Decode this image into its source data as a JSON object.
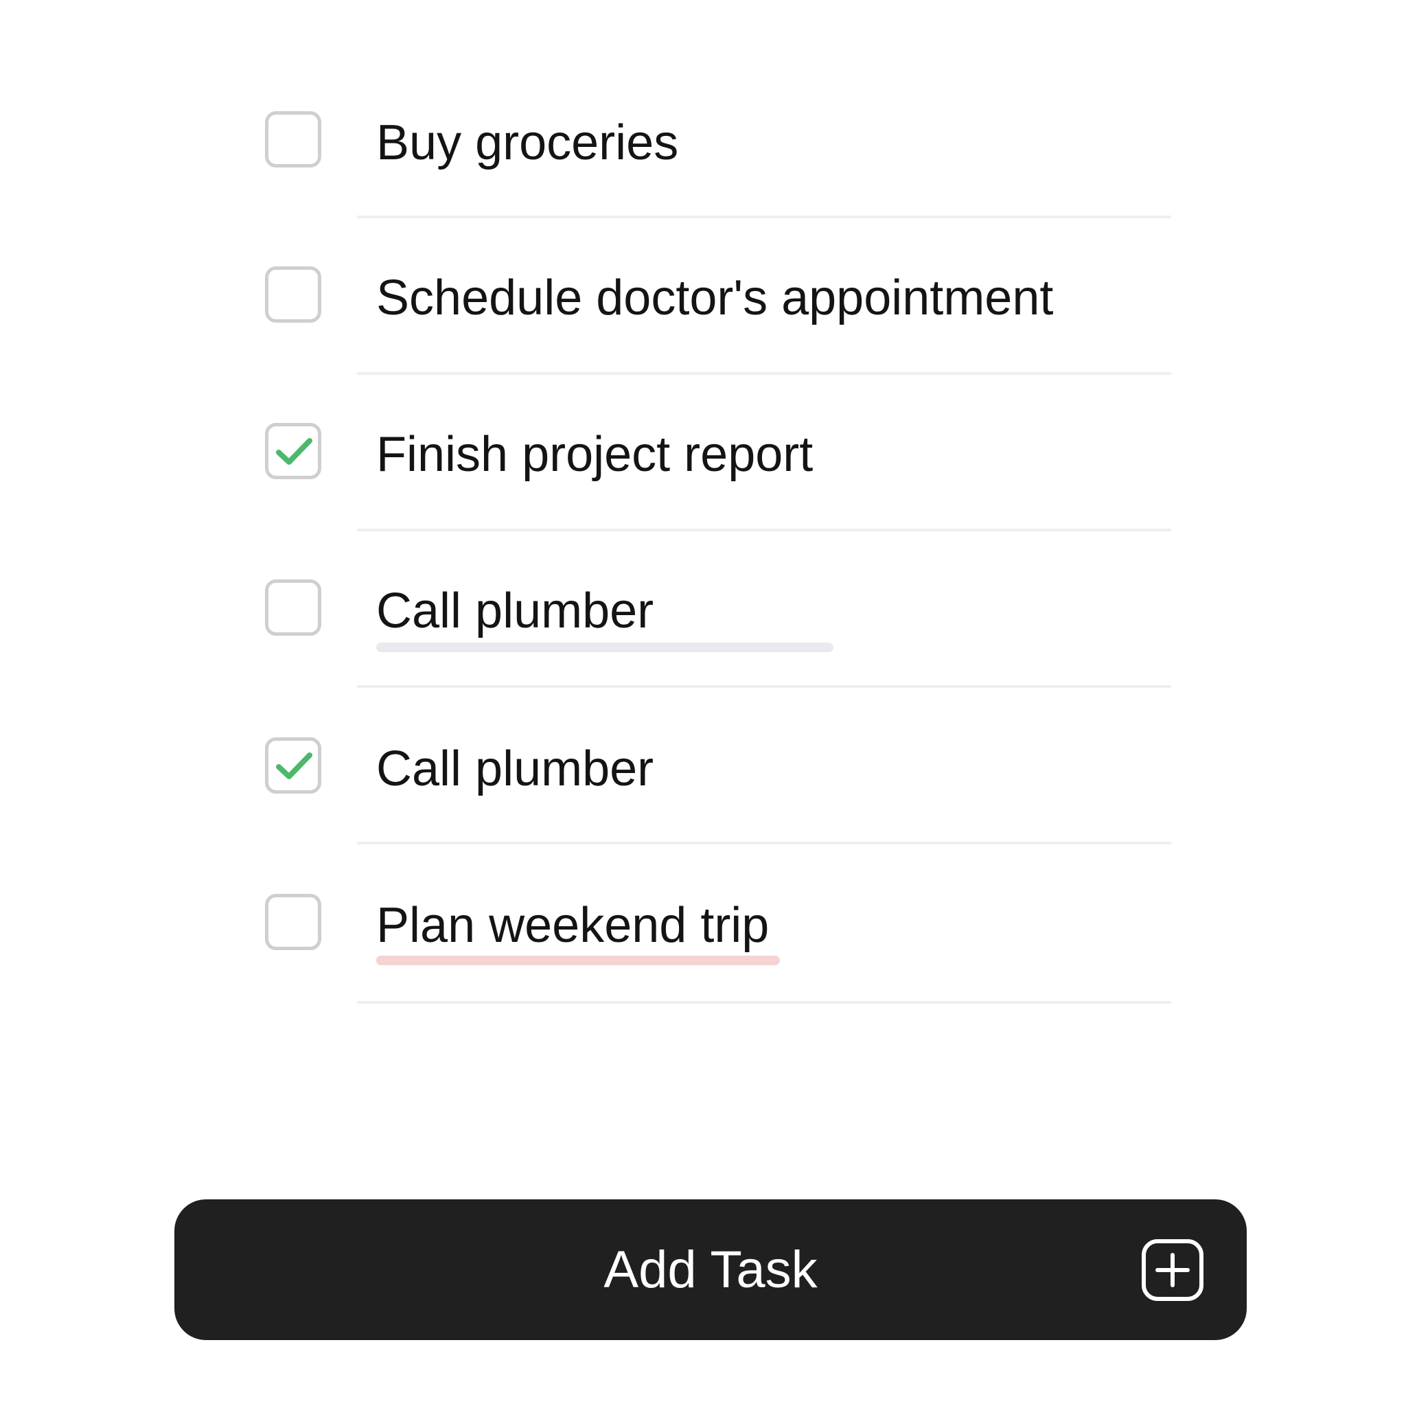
{
  "tasks": [
    {
      "label": "Buy groceries",
      "checked": false,
      "underline": ""
    },
    {
      "label": "Schedule doctor's appointment",
      "checked": false,
      "underline": ""
    },
    {
      "label": "Finish project report",
      "checked": true,
      "underline": ""
    },
    {
      "label": "Call plumber",
      "checked": false,
      "underline": "#e9e9ef"
    },
    {
      "label": "Call plumber",
      "checked": true,
      "underline": ""
    },
    {
      "label": "Plan weekend trip",
      "checked": false,
      "underline": "#f6d3d3"
    }
  ],
  "add_button": {
    "label": "Add Task",
    "icon": "plus-square-icon"
  },
  "colors": {
    "check": "#4cb86b",
    "button_bg": "#202020",
    "checkbox_border": "#cfcfcf",
    "divider": "#efefef"
  }
}
